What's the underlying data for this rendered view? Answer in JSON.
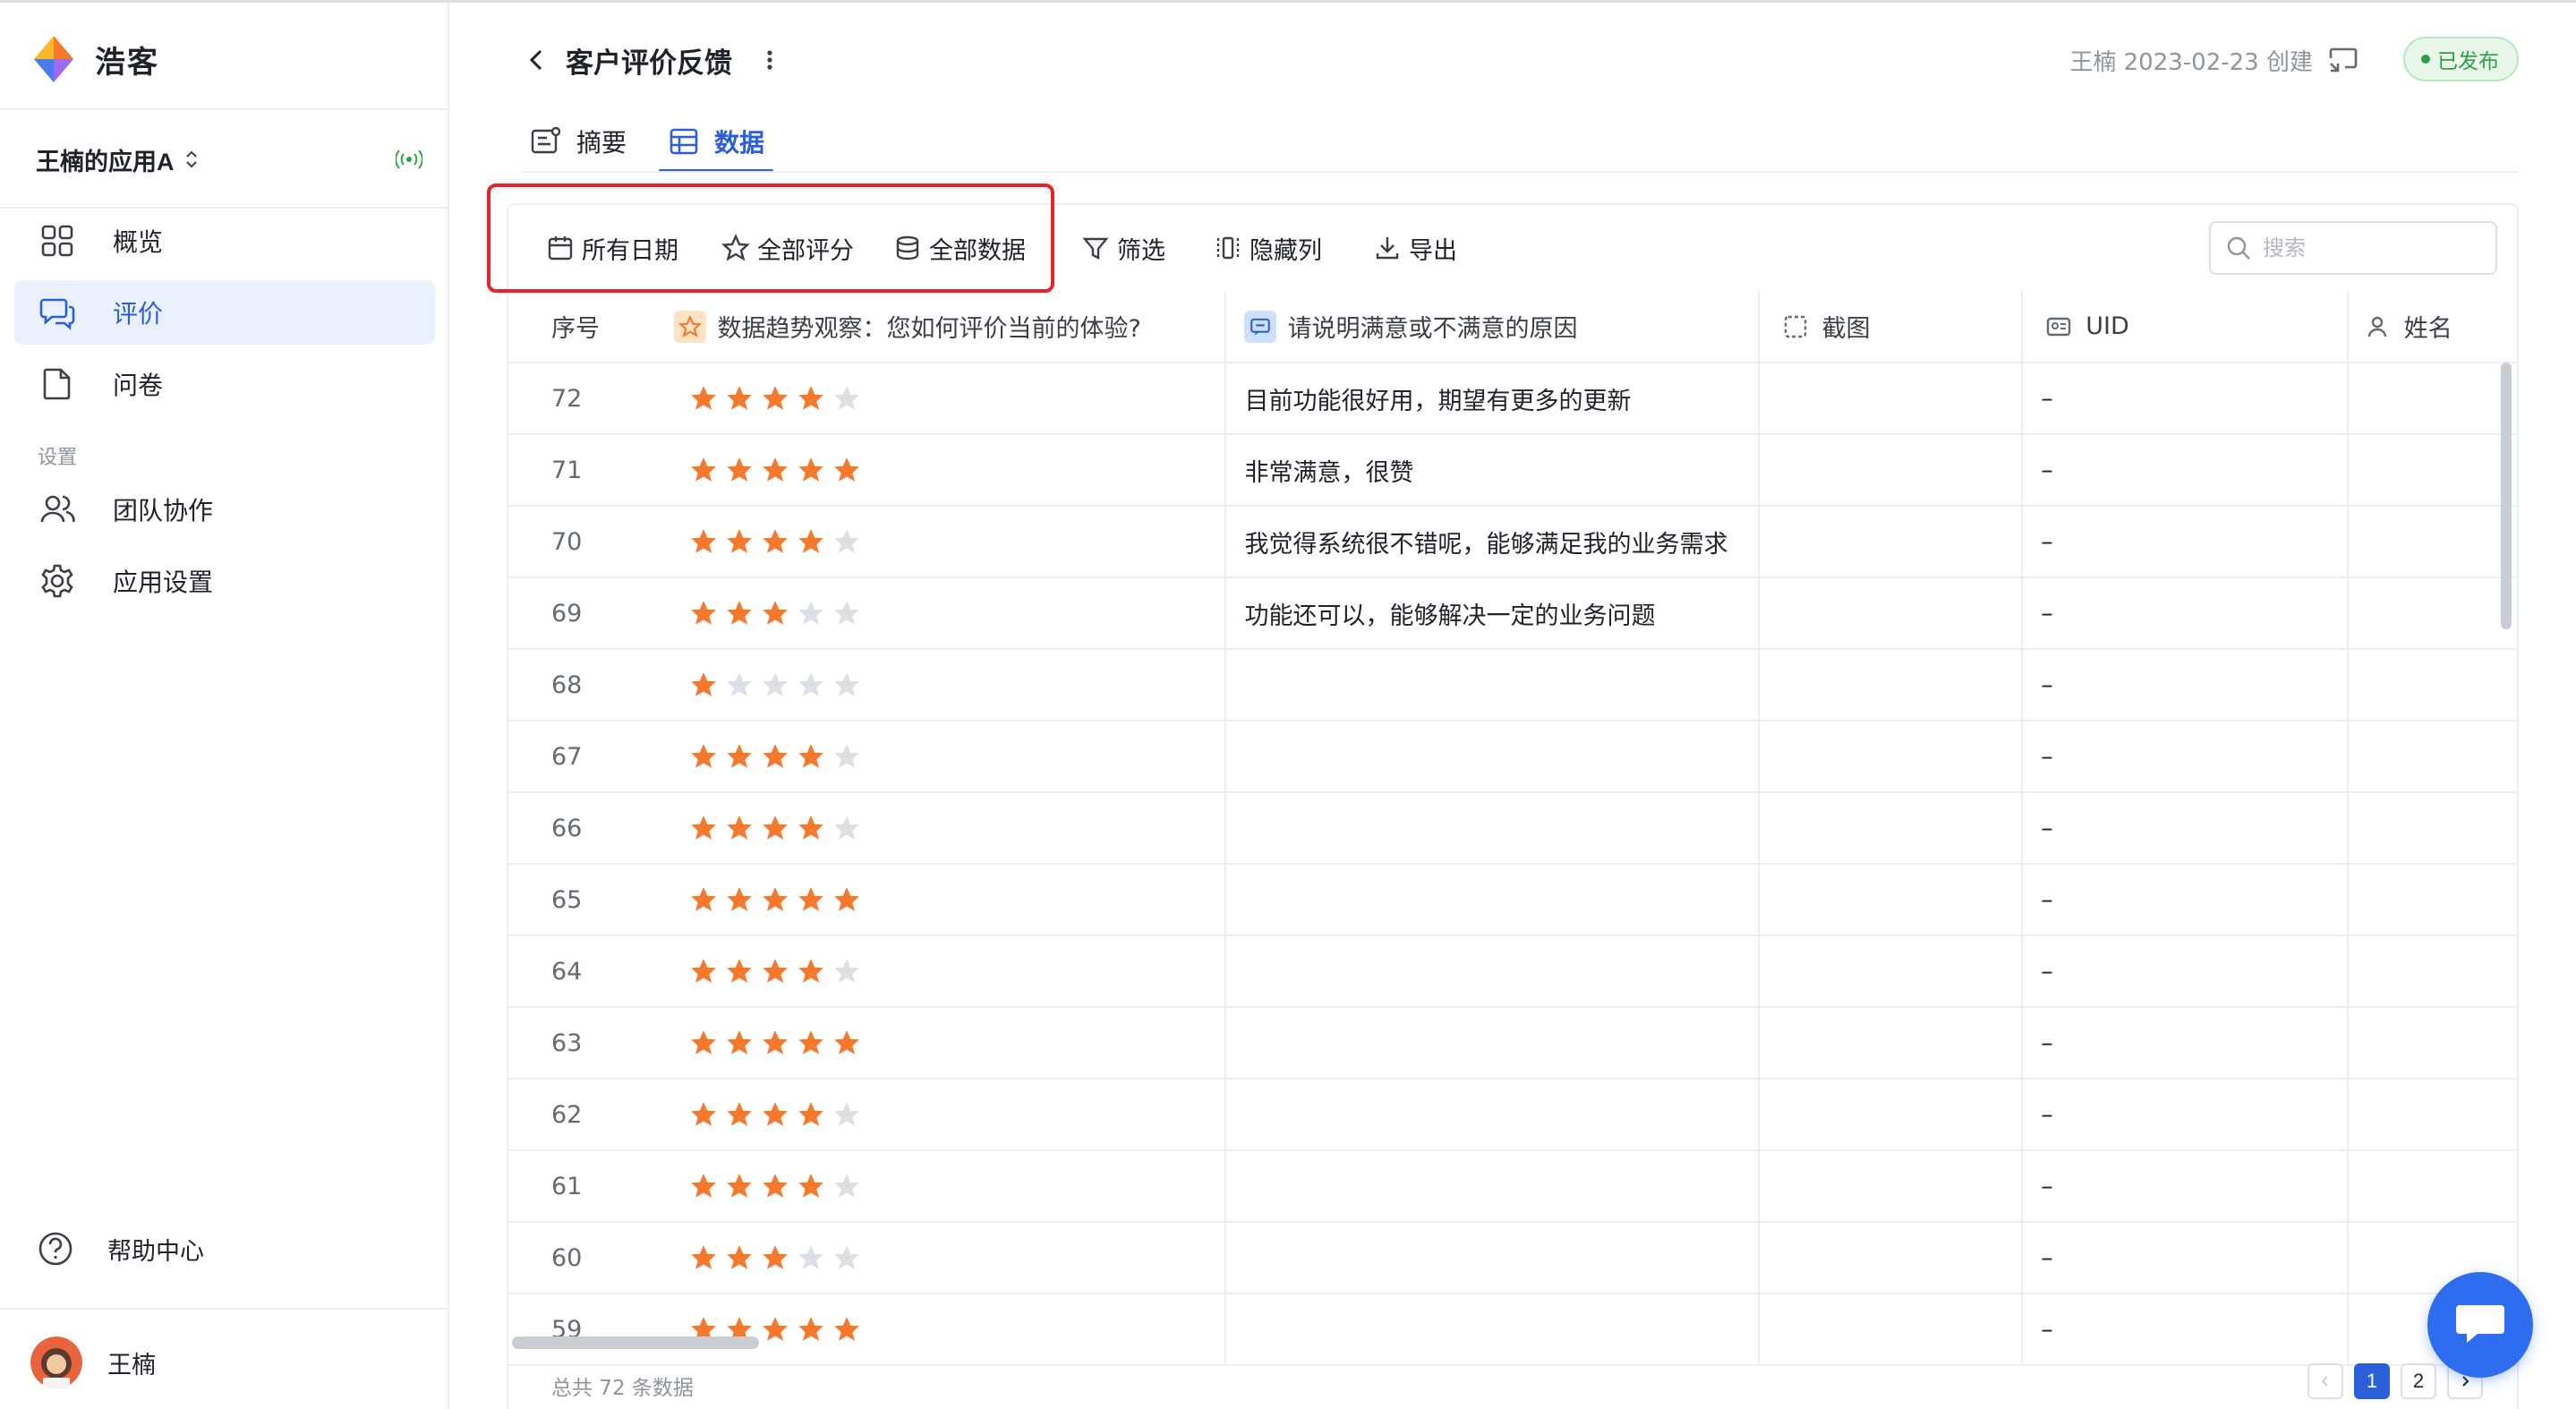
{
  "brand": {
    "name": "浩客"
  },
  "app": {
    "name": "王楠的应用A"
  },
  "sidebar": {
    "items": [
      {
        "label": "概览",
        "icon": "grid-icon"
      },
      {
        "label": "评价",
        "icon": "chat-icon",
        "active": true
      },
      {
        "label": "问卷",
        "icon": "document-icon"
      }
    ],
    "section_label": "设置",
    "settings_items": [
      {
        "label": "团队协作",
        "icon": "users-icon"
      },
      {
        "label": "应用设置",
        "icon": "gear-icon"
      }
    ],
    "help_label": "帮助中心",
    "user_name": "王楠"
  },
  "header": {
    "title": "客户评价反馈",
    "meta": "王楠 2023-02-23 创建",
    "status": "已发布"
  },
  "tabs": [
    {
      "label": "摘要",
      "icon": "summary-icon"
    },
    {
      "label": "数据",
      "icon": "table-icon",
      "active": true
    }
  ],
  "toolbar": {
    "date_label": "所有日期",
    "rating_label": "全部评分",
    "data_label": "全部数据",
    "filter_label": "筛选",
    "hide_columns_label": "隐藏列",
    "export_label": "导出",
    "search_placeholder": "搜索"
  },
  "table": {
    "columns": {
      "index": "序号",
      "rating": "数据趋势观察：您如何评价当前的体验?",
      "reason": "请说明满意或不满意的原因",
      "screenshot": "截图",
      "uid": "UID",
      "name": "姓名"
    },
    "max_rating": 5,
    "rows": [
      {
        "id": "72",
        "rating": 4,
        "reason": "目前功能很好用，期望有更多的更新",
        "uid": "–"
      },
      {
        "id": "71",
        "rating": 5,
        "reason": "非常满意，很赞",
        "uid": "–"
      },
      {
        "id": "70",
        "rating": 4,
        "reason": "我觉得系统很不错呢，能够满足我的业务需求",
        "uid": "–"
      },
      {
        "id": "69",
        "rating": 3,
        "reason": "功能还可以，能够解决一定的业务问题",
        "uid": "–"
      },
      {
        "id": "68",
        "rating": 1,
        "reason": "",
        "uid": "–"
      },
      {
        "id": "67",
        "rating": 4,
        "reason": "",
        "uid": "–"
      },
      {
        "id": "66",
        "rating": 4,
        "reason": "",
        "uid": "–"
      },
      {
        "id": "65",
        "rating": 5,
        "reason": "",
        "uid": "–"
      },
      {
        "id": "64",
        "rating": 4,
        "reason": "",
        "uid": "–"
      },
      {
        "id": "63",
        "rating": 5,
        "reason": "",
        "uid": "–"
      },
      {
        "id": "62",
        "rating": 4,
        "reason": "",
        "uid": "–"
      },
      {
        "id": "61",
        "rating": 4,
        "reason": "",
        "uid": "–"
      },
      {
        "id": "60",
        "rating": 3,
        "reason": "",
        "uid": "–"
      },
      {
        "id": "59",
        "rating": 5,
        "reason": "",
        "uid": "–"
      }
    ]
  },
  "footer": {
    "total": "总共 72 条数据",
    "pages": [
      "1",
      "2"
    ],
    "current_page": "1"
  },
  "colors": {
    "accent": "#2b5fd9",
    "star_filled": "#f5792a",
    "star_empty": "#dcdfe5",
    "published": "#2ea143",
    "highlight": "#e8212a"
  }
}
